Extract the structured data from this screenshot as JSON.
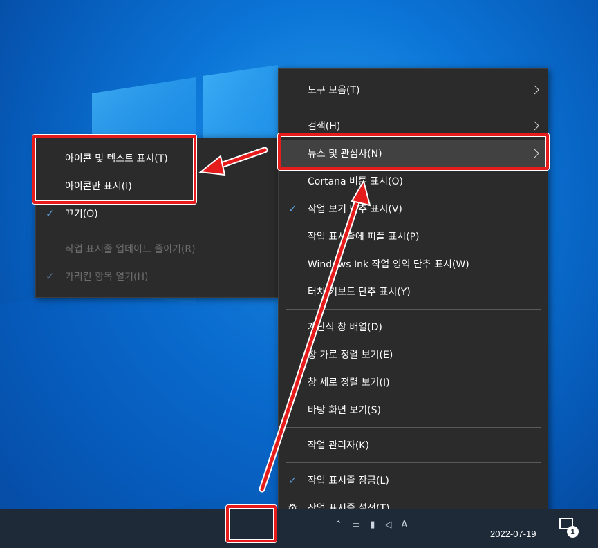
{
  "main_menu": {
    "items": [
      {
        "label": "도구 모음(T)",
        "submenu": true
      },
      {
        "label": "검색(H)",
        "submenu": true
      },
      {
        "label": "뉴스 및 관심사(N)",
        "submenu": true,
        "highlighted": true
      },
      {
        "label": "Cortana 버튼 표시(O)"
      },
      {
        "label": "작업 보기 단추 표시(V)",
        "checked": true
      },
      {
        "label": "작업 표시줄에 피플 표시(P)"
      },
      {
        "label": "Windows Ink 작업 영역 단추 표시(W)"
      },
      {
        "label": "터치 키보드 단추 표시(Y)"
      },
      {
        "label": "계단식 창 배열(D)"
      },
      {
        "label": "창 가로 정렬 보기(E)"
      },
      {
        "label": "창 세로 정렬 보기(I)"
      },
      {
        "label": "바탕 화면 보기(S)"
      },
      {
        "label": "작업 관리자(K)"
      },
      {
        "label": "작업 표시줄 잠금(L)",
        "checked": true
      },
      {
        "label": "작업 표시줄 설정(T)",
        "icon": "gear-icon"
      }
    ]
  },
  "sub_menu": {
    "items": [
      {
        "label": "아이콘 및 텍스트 표시(T)"
      },
      {
        "label": "아이콘만 표시(I)"
      },
      {
        "label": "끄기(O)",
        "checked": true
      },
      {
        "label": "작업 표시줄 업데이트 줄이기(R)",
        "disabled": true
      },
      {
        "label": "가리킨 항목 열기(H)",
        "checked": true,
        "disabled": true
      }
    ]
  },
  "taskbar": {
    "date": "2022-07-19",
    "notification_count": "1",
    "tray_icons": [
      "chevron-up-icon",
      "network-icon",
      "battery-icon",
      "volume-icon",
      "ime-icon"
    ]
  },
  "icons": {
    "check": "✓",
    "gear": "⚙"
  },
  "colors": {
    "menu_bg": "#2b2b2b",
    "highlight": "#414141",
    "annotation_red": "#e61b1b",
    "check_blue": "#5b9bd5",
    "taskbar_bg": "#1e2a38"
  }
}
